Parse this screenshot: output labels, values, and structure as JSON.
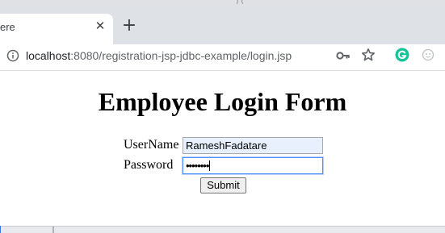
{
  "browser": {
    "tab": {
      "title": "ere",
      "close_glyph": "✕"
    },
    "new_tab_glyph": "+",
    "address_bar": {
      "host": "localhost",
      "path": ":8080/registration-jsp-jdbc-example/login.jsp"
    },
    "toolbar_icons": [
      "info-icon",
      "key-icon",
      "star-icon",
      "grammarly-icon",
      "extension-icon"
    ],
    "colors": {
      "tab_strip": "#dee1e6",
      "grammarly": "#15c39a"
    }
  },
  "page": {
    "title": "Employee Login Form",
    "form": {
      "username_label": "UserName",
      "username_value": "RameshFadatare",
      "password_label": "Password",
      "password_value": "••••••••",
      "submit_label": "Submit",
      "colors": {
        "autofill_bg": "#e8f0fe",
        "focus_ring": "#4d90fe"
      }
    }
  }
}
